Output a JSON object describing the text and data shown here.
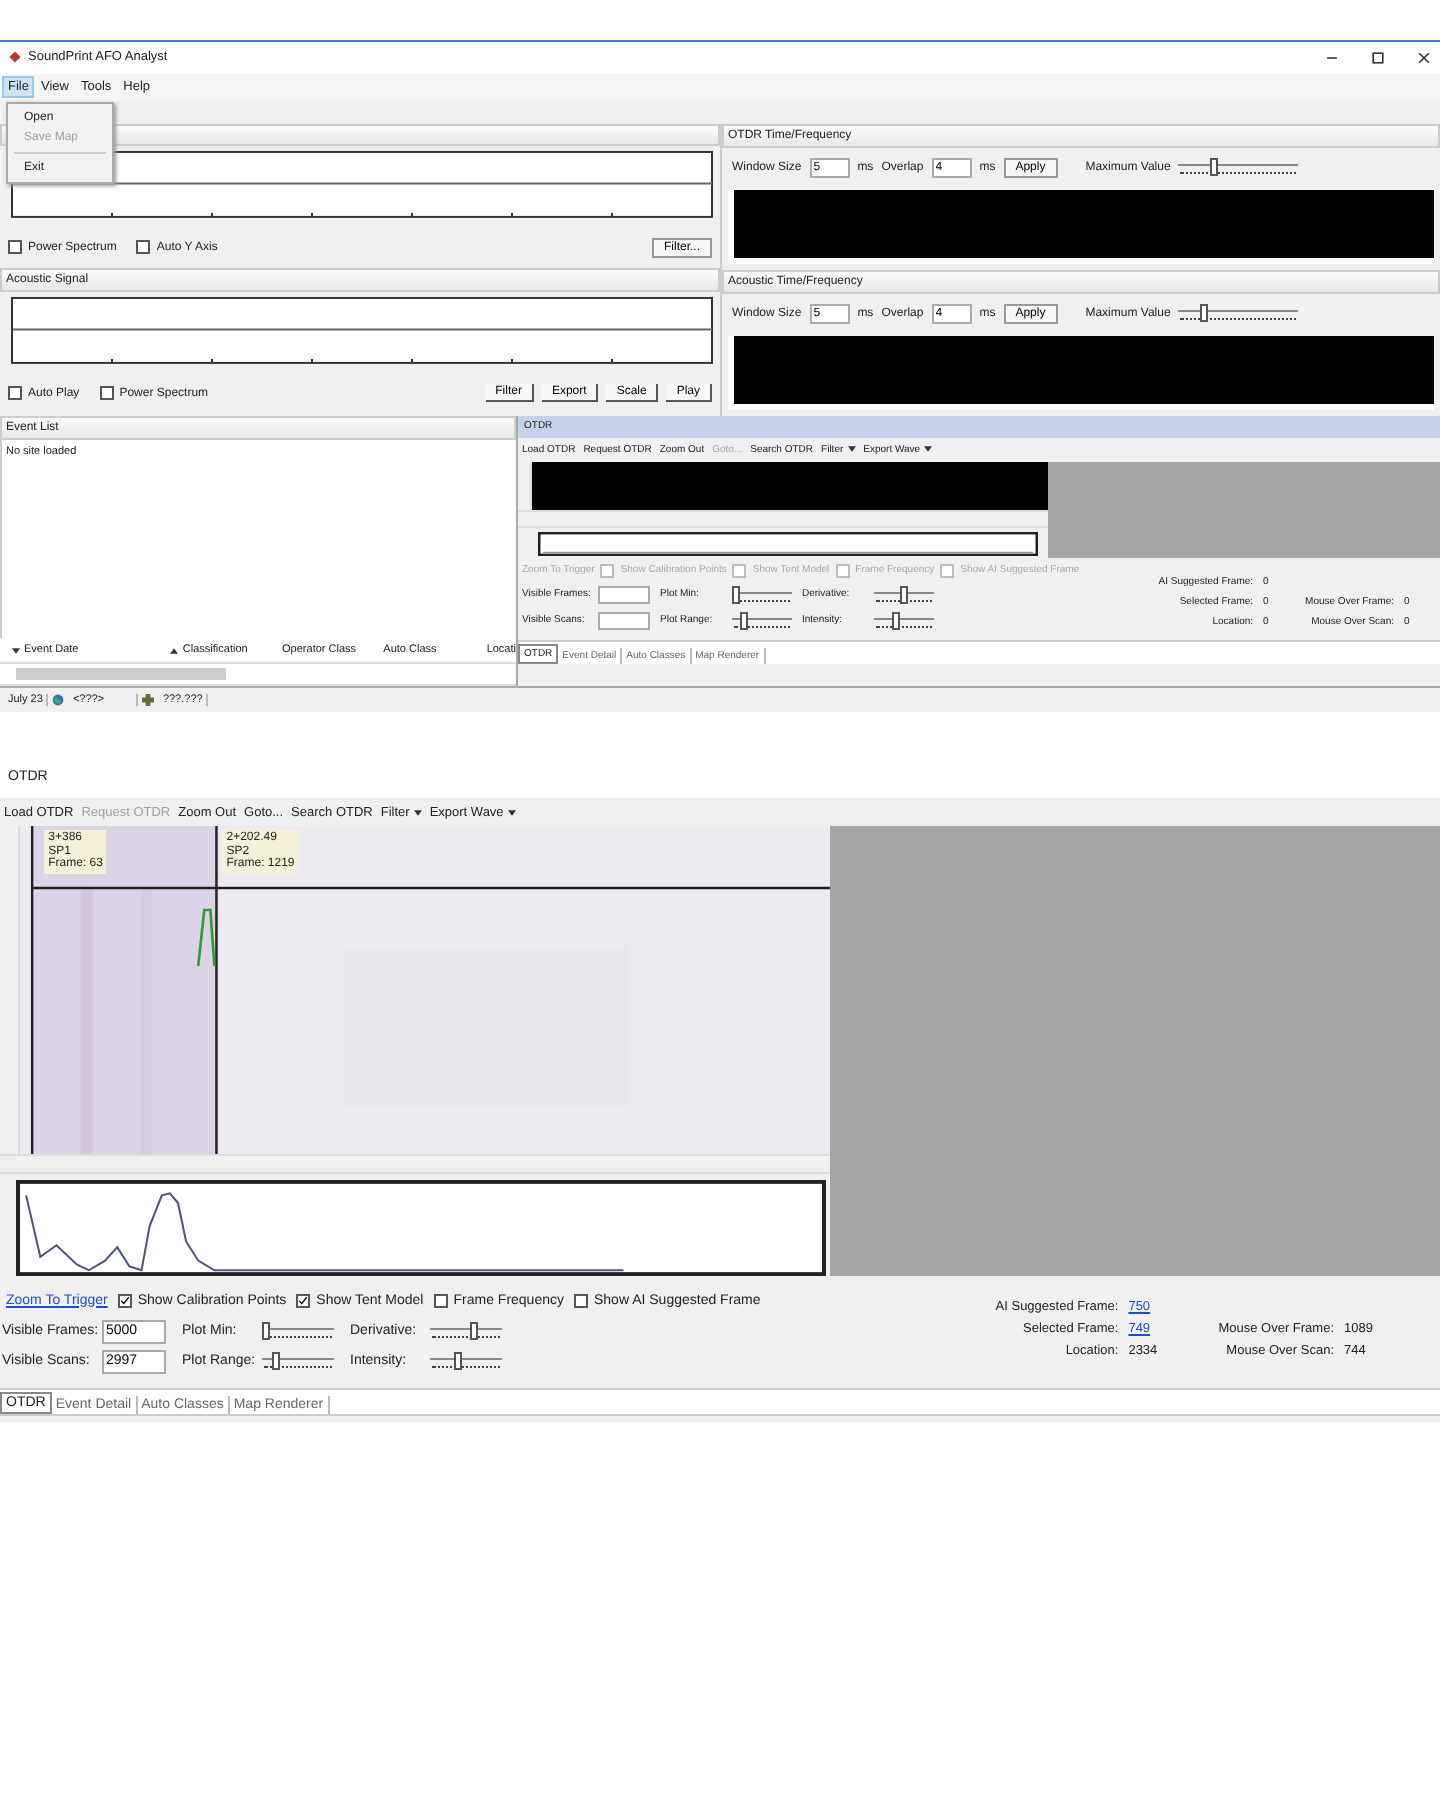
{
  "window": {
    "title": "SoundPrint AFO Analyst"
  },
  "menu": [
    {
      "label": "File",
      "selected": true
    },
    {
      "label": "View",
      "selected": false
    },
    {
      "label": "Tools",
      "selected": false
    },
    {
      "label": "Help",
      "selected": false
    }
  ],
  "file_menu": [
    {
      "kind": "item",
      "label": "Open",
      "disabled": false
    },
    {
      "kind": "item",
      "label": "Save Map",
      "disabled": true
    },
    {
      "kind": "separator"
    },
    {
      "kind": "item",
      "label": "Exit",
      "disabled": false
    }
  ],
  "otdr_signal": {
    "options": [
      {
        "label": "Power Spectrum",
        "checked": false
      },
      {
        "label": "Auto Y Axis",
        "checked": false
      }
    ],
    "buttons": [
      "Filter..."
    ]
  },
  "acoustic_signal": {
    "title": "Acoustic Signal",
    "options": [
      {
        "label": "Auto Play",
        "checked": false
      },
      {
        "label": "Power Spectrum",
        "checked": false
      }
    ],
    "buttons": [
      "Filter",
      "Export",
      "Scale",
      "Play"
    ]
  },
  "time_frequency": [
    {
      "title": "OTDR Time/Frequency",
      "window_size_label": "Window Size",
      "window_size": "5",
      "window_unit": "ms",
      "overlap_label": "Overlap",
      "overlap": "4",
      "overlap_unit": "ms",
      "apply": "Apply",
      "max_label": "Maximum Value",
      "level": 0.3
    },
    {
      "title": "Acoustic Time/Frequency",
      "window_size_label": "Window Size",
      "window_size": "5",
      "window_unit": "ms",
      "overlap_label": "Overlap",
      "overlap": "4",
      "overlap_unit": "ms",
      "apply": "Apply",
      "max_label": "Maximum Value",
      "level": 0.22
    }
  ],
  "event_list": {
    "title": "Event List",
    "message": "No site loaded",
    "columns": [
      {
        "label": "Event Date",
        "sorted": true,
        "descending": true
      },
      {
        "label": "Classification",
        "sorted": true,
        "descending": false
      },
      {
        "label": "Operator Class",
        "sorted": false
      },
      {
        "label": "Auto Class",
        "sorted": false
      },
      {
        "label": "Locati",
        "sorted": false
      }
    ]
  },
  "status_bar": {
    "date": "July 23",
    "site": "<???>",
    "position": "???.???"
  },
  "otdr_panels": [
    {
      "kind": "empty",
      "title": "OTDR",
      "toolbar": [
        {
          "label": "Load OTDR",
          "disabled": false,
          "dropdown": false
        },
        {
          "label": "Request OTDR",
          "disabled": false,
          "dropdown": false
        },
        {
          "label": "Zoom Out",
          "disabled": false,
          "dropdown": false
        },
        {
          "label": "Goto...",
          "disabled": true,
          "dropdown": false
        },
        {
          "label": "Search OTDR",
          "disabled": false,
          "dropdown": false
        },
        {
          "label": "Filter",
          "disabled": false,
          "dropdown": true
        },
        {
          "label": "Export Wave",
          "disabled": false,
          "dropdown": true
        }
      ],
      "zoom_link": {
        "label": "Zoom To Trigger",
        "disabled": true
      },
      "options": [
        {
          "label": "Show Calibration Points",
          "checked": false,
          "disabled": true
        },
        {
          "label": "Show Tent Model",
          "checked": false,
          "disabled": true
        },
        {
          "label": "Frame Frequency",
          "checked": false,
          "disabled": true
        },
        {
          "label": "Show AI Suggested Frame",
          "checked": false,
          "disabled": true
        }
      ],
      "controls": [
        {
          "field": {
            "label": "Visible Frames:"
          },
          "sliders": [
            {
              "label": "Plot Min:",
              "level": 0.05
            },
            {
              "label": "Derivative:",
              "level": 0.5
            }
          ]
        },
        {
          "field": {
            "label": "Visible Scans:"
          },
          "sliders": [
            {
              "label": "Plot Range:",
              "level": 0.2
            },
            {
              "label": "Intensity:",
              "level": 0.35
            }
          ]
        }
      ],
      "stats": [
        {
          "label": "AI Suggested Frame:",
          "value": "0",
          "link": false
        },
        {
          "label": "Selected Frame:",
          "value": "0",
          "link": false
        },
        {
          "label": "Location:",
          "value": "0",
          "link": false
        },
        {
          "label": "Mouse Over Frame:",
          "value": "0",
          "link": false
        },
        {
          "label": "Mouse Over Scan:",
          "value": "0",
          "link": false
        }
      ],
      "tabs": [
        {
          "label": "OTDR",
          "selected": true
        },
        {
          "label": "Event Detail",
          "selected": false
        },
        {
          "label": "Auto Classes",
          "selected": false
        },
        {
          "label": "Map Renderer",
          "selected": false
        }
      ]
    },
    {
      "kind": "scan",
      "title": "OTDR",
      "toolbar": [
        {
          "label": "Load OTDR",
          "disabled": false,
          "dropdown": false
        },
        {
          "label": "Request OTDR",
          "disabled": true,
          "dropdown": false
        },
        {
          "label": "Zoom Out",
          "disabled": false,
          "dropdown": false
        },
        {
          "label": "Goto...",
          "disabled": false,
          "dropdown": false
        },
        {
          "label": "Search OTDR",
          "disabled": false,
          "dropdown": false
        },
        {
          "label": "Filter",
          "disabled": false,
          "dropdown": true
        },
        {
          "label": "Export Wave",
          "disabled": false,
          "dropdown": true
        }
      ],
      "markers": [
        {
          "lines": [
            "3+386",
            "SP1",
            "Frame: 63"
          ]
        },
        {
          "lines": [
            "2+202.49",
            "SP2",
            "Frame: 1219"
          ]
        }
      ],
      "zoom_link": {
        "label": "Zoom To Trigger",
        "disabled": false
      },
      "options": [
        {
          "label": "Show Calibration Points",
          "checked": true,
          "disabled": false
        },
        {
          "label": "Show Tent Model",
          "checked": true,
          "disabled": false
        },
        {
          "label": "Frame Frequency",
          "checked": false,
          "disabled": false
        },
        {
          "label": "Show AI Suggested Frame",
          "checked": false,
          "disabled": false
        }
      ],
      "controls": [
        {
          "field": {
            "label": "Visible Frames:",
            "value": "5000"
          },
          "sliders": [
            {
              "label": "Plot Min:",
              "level": 0.05
            },
            {
              "label": "Derivative:",
              "level": 0.6
            }
          ]
        },
        {
          "field": {
            "label": "Visible Scans:",
            "value": "2997"
          },
          "sliders": [
            {
              "label": "Plot Range:",
              "level": 0.2
            },
            {
              "label": "Intensity:",
              "level": 0.4
            }
          ]
        }
      ],
      "stats": [
        {
          "label": "AI Suggested Frame:",
          "value": "750",
          "link": true
        },
        {
          "label": "Selected Frame:",
          "value": "749",
          "link": true
        },
        {
          "label": "Location:",
          "value": "2334",
          "link": false
        },
        {
          "label": "Mouse Over Frame:",
          "value": "1089",
          "link": false
        },
        {
          "label": "Mouse Over Scan:",
          "value": "744",
          "link": false
        }
      ],
      "tabs": [
        {
          "label": "OTDR",
          "selected": true
        },
        {
          "label": "Event Detail",
          "selected": false
        },
        {
          "label": "Auto Classes",
          "selected": false
        },
        {
          "label": "Map Renderer",
          "selected": false
        }
      ]
    }
  ]
}
